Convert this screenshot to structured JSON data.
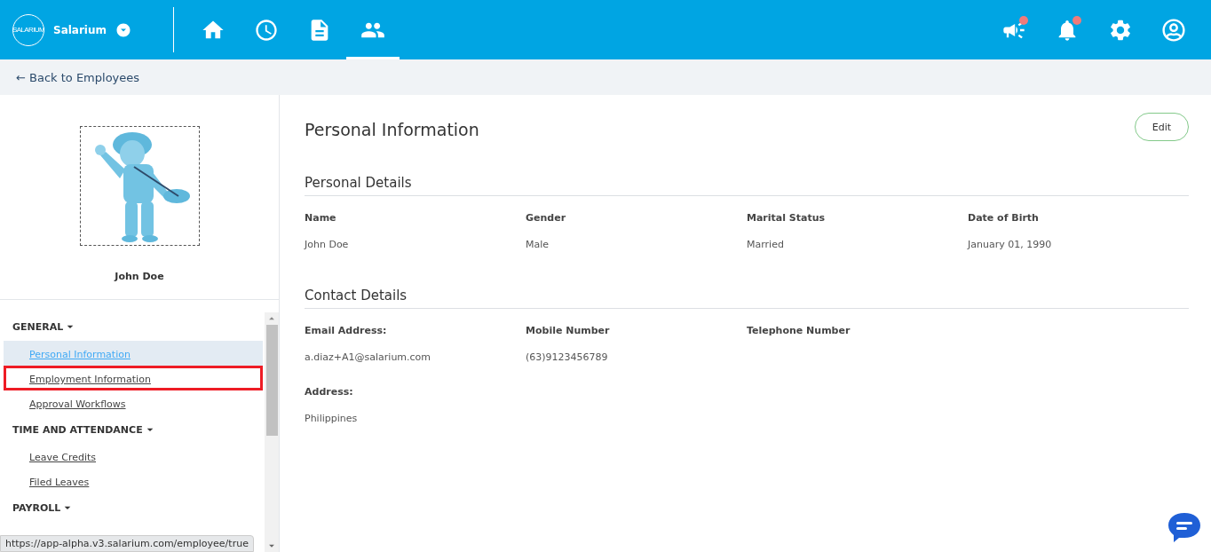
{
  "brand": {
    "name": "Salarium",
    "logo_text": "SALARIUM"
  },
  "nav_tabs": [
    {
      "kind": "home",
      "selected": false
    },
    {
      "kind": "clock",
      "selected": false
    },
    {
      "kind": "document",
      "selected": false
    },
    {
      "kind": "people",
      "selected": true
    }
  ],
  "header_actions": [
    {
      "kind": "megaphone",
      "badge": true
    },
    {
      "kind": "bell",
      "badge": true
    },
    {
      "kind": "settings",
      "badge": false
    },
    {
      "kind": "account",
      "badge": false
    }
  ],
  "back_link": "← Back to Employees",
  "profile": {
    "name": "John Doe"
  },
  "sidebar": {
    "sections": [
      {
        "title": "GENERAL",
        "expanded": true,
        "items": [
          {
            "label": "Personal Information",
            "selected": true,
            "highlighted": false
          },
          {
            "label": "Employment Information",
            "selected": false,
            "highlighted": true
          },
          {
            "label": "Approval Workflows",
            "selected": false,
            "highlighted": false
          }
        ]
      },
      {
        "title": "TIME AND ATTENDANCE",
        "expanded": true,
        "items": [
          {
            "label": "Leave Credits",
            "selected": false,
            "highlighted": false
          },
          {
            "label": "Filed Leaves",
            "selected": false,
            "highlighted": false
          }
        ]
      },
      {
        "title": "PAYROLL",
        "expanded": true
      }
    ]
  },
  "status_url": "https://app-alpha.v3.salarium.com/employee/true",
  "page": {
    "title": "Personal Information",
    "edit_button": "Edit",
    "sections": [
      {
        "title": "Personal Details",
        "rows": [
          [
            {
              "label": "Name",
              "value": "John Doe"
            },
            {
              "label": "Gender",
              "value": "Male"
            },
            {
              "label": "Marital Status",
              "value": "Married"
            },
            {
              "label": "Date of Birth",
              "value": "January 01, 1990"
            }
          ]
        ]
      },
      {
        "title": "Contact Details",
        "rows": [
          [
            {
              "label": "Email Address:",
              "value": "a.diaz+A1@salarium.com"
            },
            {
              "label": "Mobile Number",
              "value": "(63)9123456789"
            },
            {
              "label": "Telephone Number"
            }
          ],
          [
            {
              "label": "Address:",
              "value": "Philippines"
            }
          ]
        ]
      }
    ]
  }
}
